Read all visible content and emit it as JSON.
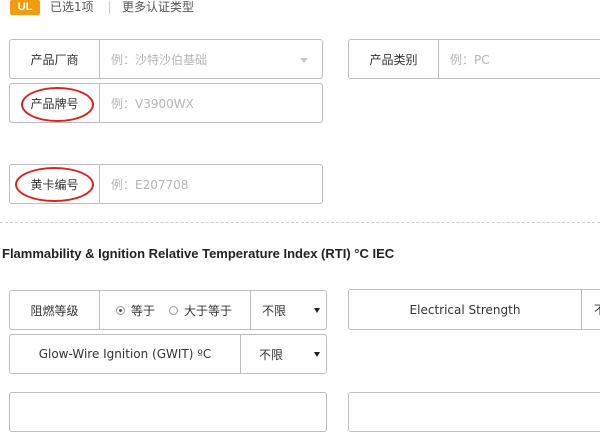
{
  "topbar": {
    "badge": "UL",
    "selected": "已选1项",
    "more": "更多认证类型"
  },
  "product_fields": {
    "manufacturer": {
      "label": "产品厂商",
      "placeholder": "例：沙特沙伯基础"
    },
    "category": {
      "label": "产品类别",
      "placeholder": "例：PC"
    },
    "brand_model": {
      "label": "产品牌号",
      "placeholder": "例：V3900WX"
    },
    "yellow_card": {
      "label": "黄卡编号",
      "placeholder": "例：E207708"
    }
  },
  "section": {
    "title": "Flammability & Ignition Relative Temperature Index (RTI) °C IEC"
  },
  "filters": {
    "flame_grade": {
      "label": "阻燃等级",
      "option_equal": "等于",
      "option_ge": "大于等于",
      "selected_option": "等于",
      "select_value": "不限"
    },
    "electrical_strength": {
      "label": "Electrical Strength",
      "select_value": "不"
    },
    "gwit": {
      "label": "Glow-Wire Ignition (GWIT) ºC",
      "select_value": "不限"
    }
  },
  "colors": {
    "badge": "#f39c12",
    "annotation_circle": "#dd2222",
    "border": "#bdbdbd",
    "placeholder": "#b5b5b5"
  }
}
